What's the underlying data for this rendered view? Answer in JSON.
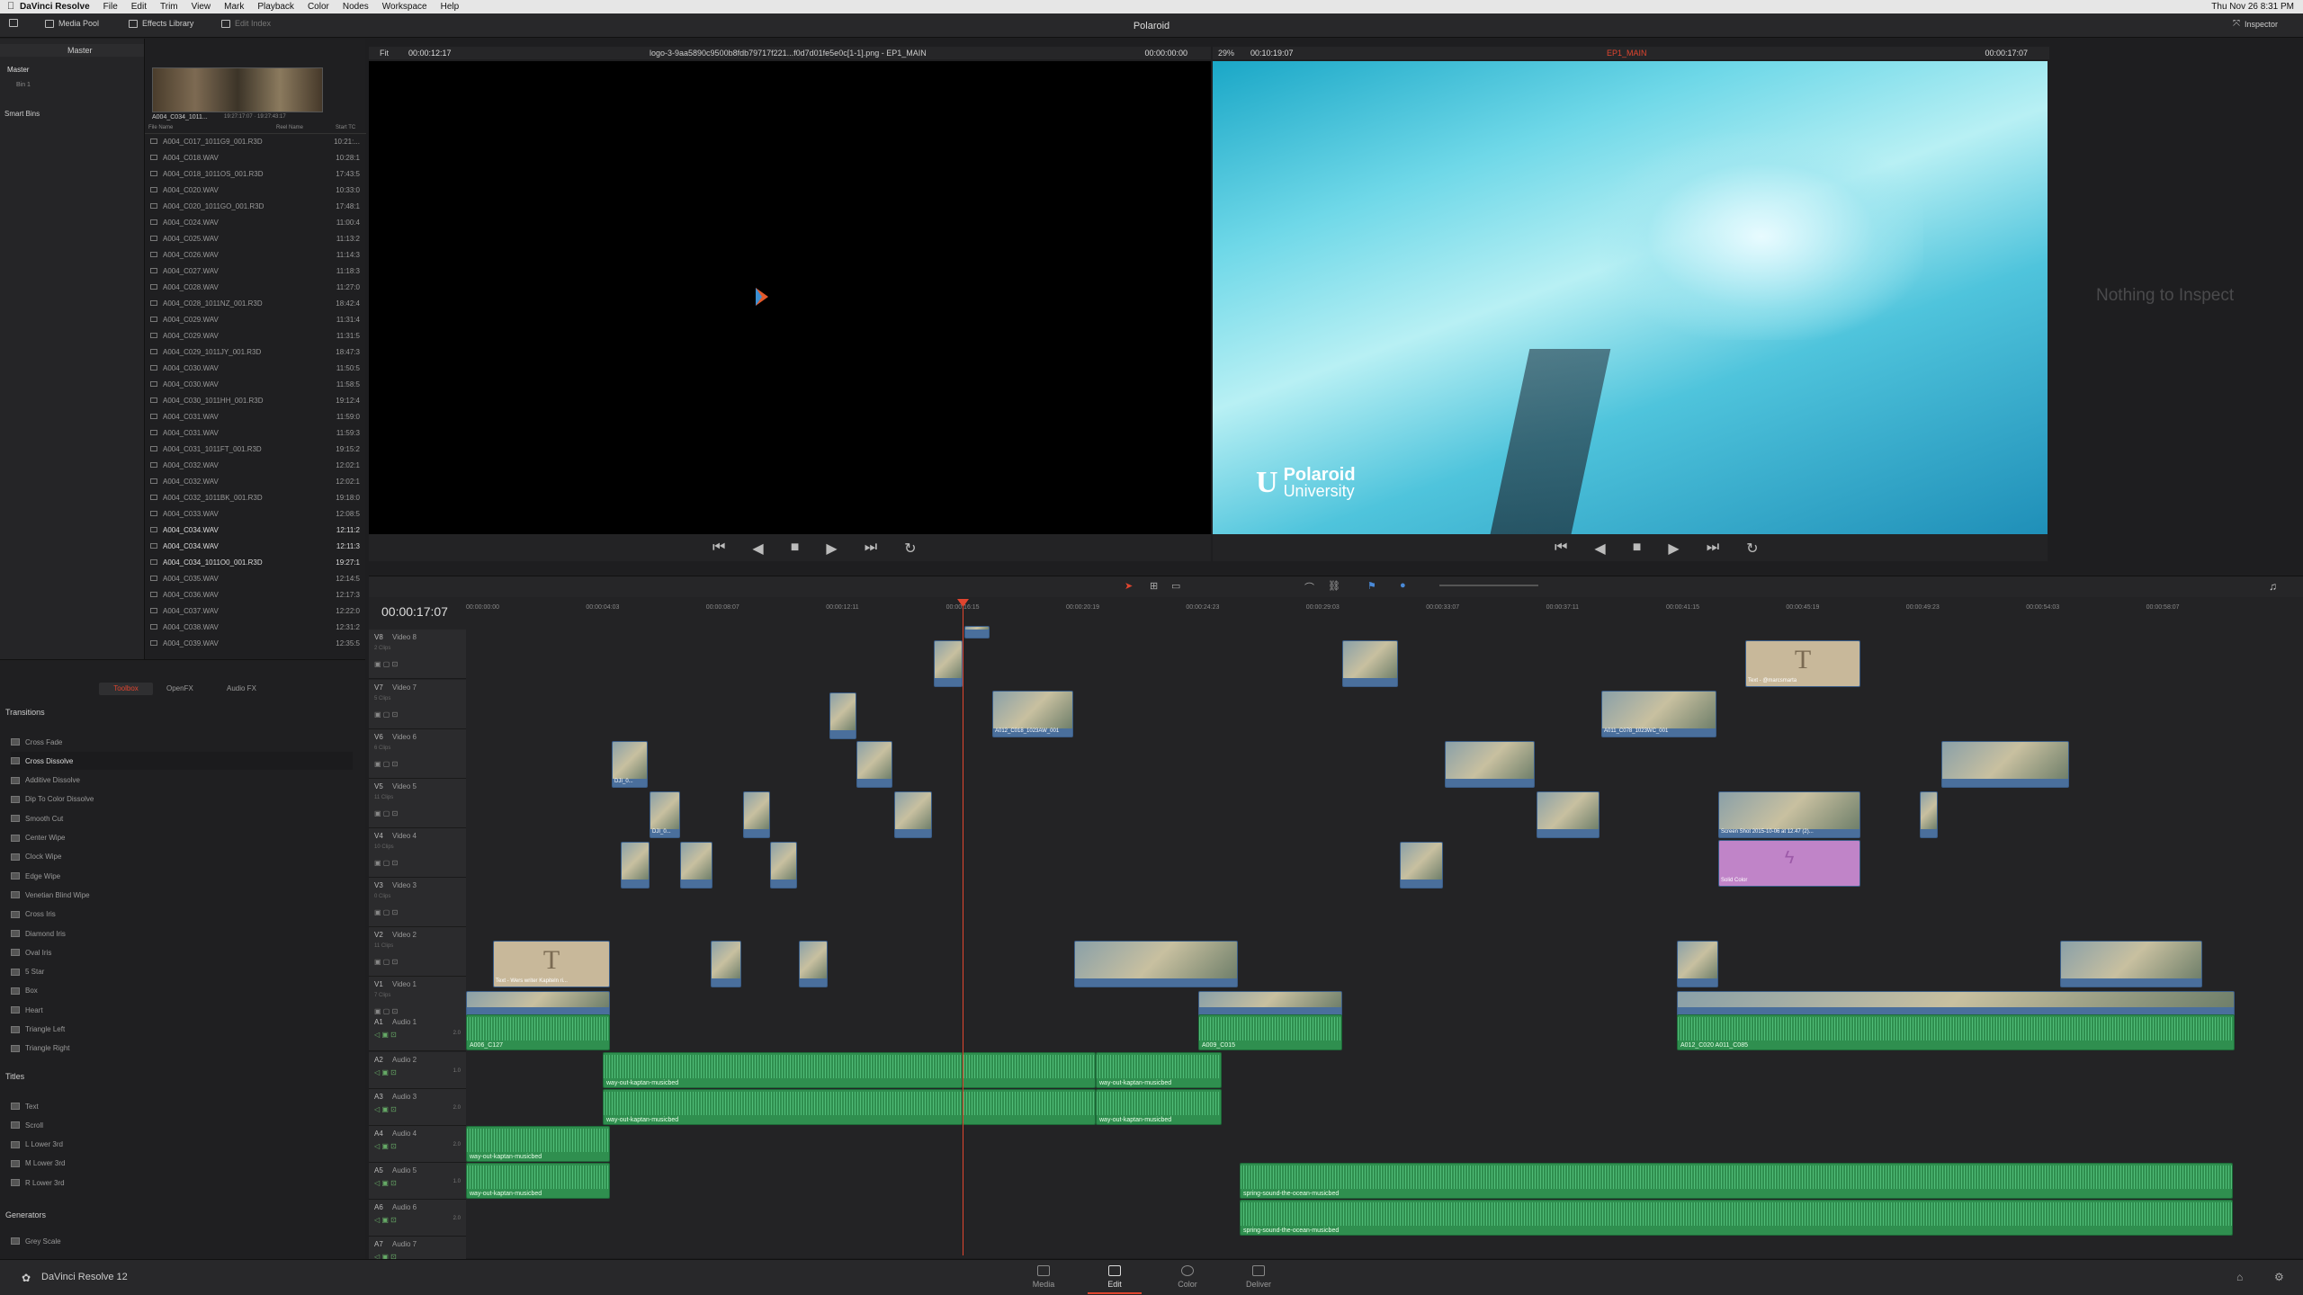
{
  "menubar": {
    "app_name": "DaVinci Resolve",
    "items": [
      "File",
      "Edit",
      "Trim",
      "View",
      "Mark",
      "Playback",
      "Color",
      "Nodes",
      "Workspace",
      "Help"
    ],
    "clock": "Thu Nov 26  8:31 PM"
  },
  "toolbar": {
    "media_pool": "Media Pool",
    "effects_library": "Effects Library",
    "edit_index": "Edit Index",
    "project_title": "Polaroid",
    "inspector": "Inspector"
  },
  "media_pool": {
    "bin_title": "Master",
    "bins": [
      "Master",
      "Bin 1"
    ],
    "smart_bins": "Smart Bins",
    "thumb_caption": "A004_C034_1011...",
    "thumb_tc": "19:27:17:07 · 19:27:43:17",
    "columns": [
      "File Name",
      "Reel Name",
      "Start TC"
    ],
    "files": [
      {
        "name": "A004_C017_1011G9_001.R3D",
        "tc": "10:21:..."
      },
      {
        "name": "A004_C018.WAV",
        "tc": "10:28:1"
      },
      {
        "name": "A004_C018_1011OS_001.R3D",
        "tc": "17:43:5"
      },
      {
        "name": "A004_C020.WAV",
        "tc": "10:33:0"
      },
      {
        "name": "A004_C020_1011GO_001.R3D",
        "tc": "17:48:1"
      },
      {
        "name": "A004_C024.WAV",
        "tc": "11:00:4"
      },
      {
        "name": "A004_C025.WAV",
        "tc": "11:13:2"
      },
      {
        "name": "A004_C026.WAV",
        "tc": "11:14:3"
      },
      {
        "name": "A004_C027.WAV",
        "tc": "11:18:3"
      },
      {
        "name": "A004_C028.WAV",
        "tc": "11:27:0"
      },
      {
        "name": "A004_C028_1011NZ_001.R3D",
        "tc": "18:42:4"
      },
      {
        "name": "A004_C029.WAV",
        "tc": "11:31:4"
      },
      {
        "name": "A004_C029.WAV",
        "tc": "11:31:5"
      },
      {
        "name": "A004_C029_1011JY_001.R3D",
        "tc": "18:47:3"
      },
      {
        "name": "A004_C030.WAV",
        "tc": "11:50:5"
      },
      {
        "name": "A004_C030.WAV",
        "tc": "11:58:5"
      },
      {
        "name": "A004_C030_1011HH_001.R3D",
        "tc": "19:12:4"
      },
      {
        "name": "A004_C031.WAV",
        "tc": "11:59:0"
      },
      {
        "name": "A004_C031.WAV",
        "tc": "11:59:3"
      },
      {
        "name": "A004_C031_1011FT_001.R3D",
        "tc": "19:15:2"
      },
      {
        "name": "A004_C032.WAV",
        "tc": "12:02:1"
      },
      {
        "name": "A004_C032.WAV",
        "tc": "12:02:1"
      },
      {
        "name": "A004_C032_1011BK_001.R3D",
        "tc": "19:18:0"
      },
      {
        "name": "A004_C033.WAV",
        "tc": "12:08:5"
      },
      {
        "name": "A004_C034.WAV",
        "tc": "12:11:2"
      },
      {
        "name": "A004_C034.WAV",
        "tc": "12:11:3"
      },
      {
        "name": "A004_C034_1011O0_001.R3D",
        "tc": "19:27:1"
      },
      {
        "name": "A004_C035.WAV",
        "tc": "12:14:5"
      },
      {
        "name": "A004_C036.WAV",
        "tc": "12:17:3"
      },
      {
        "name": "A004_C037.WAV",
        "tc": "12:22:0"
      },
      {
        "name": "A004_C038.WAV",
        "tc": "12:31:2"
      },
      {
        "name": "A004_C039.WAV",
        "tc": "12:35:5"
      }
    ]
  },
  "effects": {
    "tabs": [
      "Toolbox",
      "OpenFX",
      "Audio FX"
    ],
    "transitions_label": "Transitions",
    "transitions": [
      "Cross Fade",
      "Cross Dissolve",
      "Additive Dissolve",
      "Dip To Color Dissolve",
      "Smooth Cut",
      "Center Wipe",
      "Clock Wipe",
      "Edge Wipe",
      "Venetian Blind Wipe",
      "Cross Iris",
      "Diamond Iris",
      "Oval Iris",
      "5 Star",
      "Box",
      "Heart",
      "Triangle Left",
      "Triangle Right"
    ],
    "titles_label": "Titles",
    "titles": [
      "Text",
      "Scroll",
      "L Lower 3rd",
      "M Lower 3rd",
      "R Lower 3rd"
    ],
    "generators_label": "Generators",
    "generators": [
      "Grey Scale"
    ]
  },
  "source_viewer": {
    "zoom": "Fit",
    "timecode": "00:00:12:17",
    "clip_name": "logo-3-9aa5890c9500b8fdb79717f221...f0d7d01fe5e0c[1-1].png - EP1_MAIN",
    "tc_right": "00:00:00:00"
  },
  "program_viewer": {
    "zoom": "29%",
    "timecode": "00:10:19:07",
    "timeline_name": "EP1_MAIN",
    "tc_right": "00:00:17:07",
    "logo_line1": "Polaroid",
    "logo_line2": "University"
  },
  "inspector": {
    "empty_text": "Nothing to Inspect"
  },
  "timeline": {
    "timecode": "00:00:17:07",
    "ruler": [
      "00:00:00:00",
      "00:00:04:03",
      "00:00:08:07",
      "00:00:12:11",
      "00:00:16:15",
      "00:00:20:19",
      "00:00:24:23",
      "00:00:29:03",
      "00:00:33:07",
      "00:00:37:11",
      "00:00:41:15",
      "00:00:45:19",
      "00:00:49:23",
      "00:00:54:03",
      "00:00:58:07"
    ],
    "video_tracks": [
      {
        "id": "V8",
        "name": "Video 8",
        "count": "2 Clips"
      },
      {
        "id": "V7",
        "name": "Video 7",
        "count": "5 Clips"
      },
      {
        "id": "V6",
        "name": "Video 6",
        "count": "6 Clips"
      },
      {
        "id": "V5",
        "name": "Video 5",
        "count": "11 Clips"
      },
      {
        "id": "V4",
        "name": "Video 4",
        "count": "10 Clips"
      },
      {
        "id": "V3",
        "name": "Video 3",
        "count": "0 Clips"
      },
      {
        "id": "V2",
        "name": "Video 2",
        "count": "11 Clips"
      },
      {
        "id": "V1",
        "name": "Video 1",
        "count": "7 Clips"
      }
    ],
    "audio_tracks": [
      {
        "id": "A1",
        "name": "Audio 1",
        "ch": "2.0"
      },
      {
        "id": "A2",
        "name": "Audio 2",
        "ch": "1.0"
      },
      {
        "id": "A3",
        "name": "Audio 3",
        "ch": "2.0"
      },
      {
        "id": "A4",
        "name": "Audio 4",
        "ch": "2.0"
      },
      {
        "id": "A5",
        "name": "Audio 5",
        "ch": "1.0"
      },
      {
        "id": "A6",
        "name": "Audio 6",
        "ch": "2.0"
      },
      {
        "id": "A7",
        "name": "Audio 7",
        "ch": ""
      }
    ],
    "clip_labels": {
      "dji_a": "DJI_0...",
      "dji_b": "DJI_0...",
      "title_a": "Text - @marcsmarta",
      "title_b": "Text - Wers writer Kapiteln ri...",
      "solid": "Solid Color",
      "screenshot": "Screen Shot 2015-10-06 at 12.47 (2)...",
      "a012": "A012_C018_1023AW_001",
      "a011": "A011_C078_1023WC_001",
      "v1a": "A006_C127",
      "v1b": "A009_C015",
      "v1c": "A012_C020 A011_C085",
      "aud_kaptan": "way-out-kaptan-musicbed",
      "aud_spring": "spring-sound-the-ocean-musicbed"
    }
  },
  "pages": [
    "Media",
    "Edit",
    "Color",
    "Deliver"
  ],
  "active_page": "Edit",
  "footer_app": "DaVinci Resolve 12",
  "colors": {
    "accent": "#e0452f",
    "video_clip": "#4a6f9c",
    "audio_clip": "#2f8f4f",
    "water": "#3fc3da"
  }
}
